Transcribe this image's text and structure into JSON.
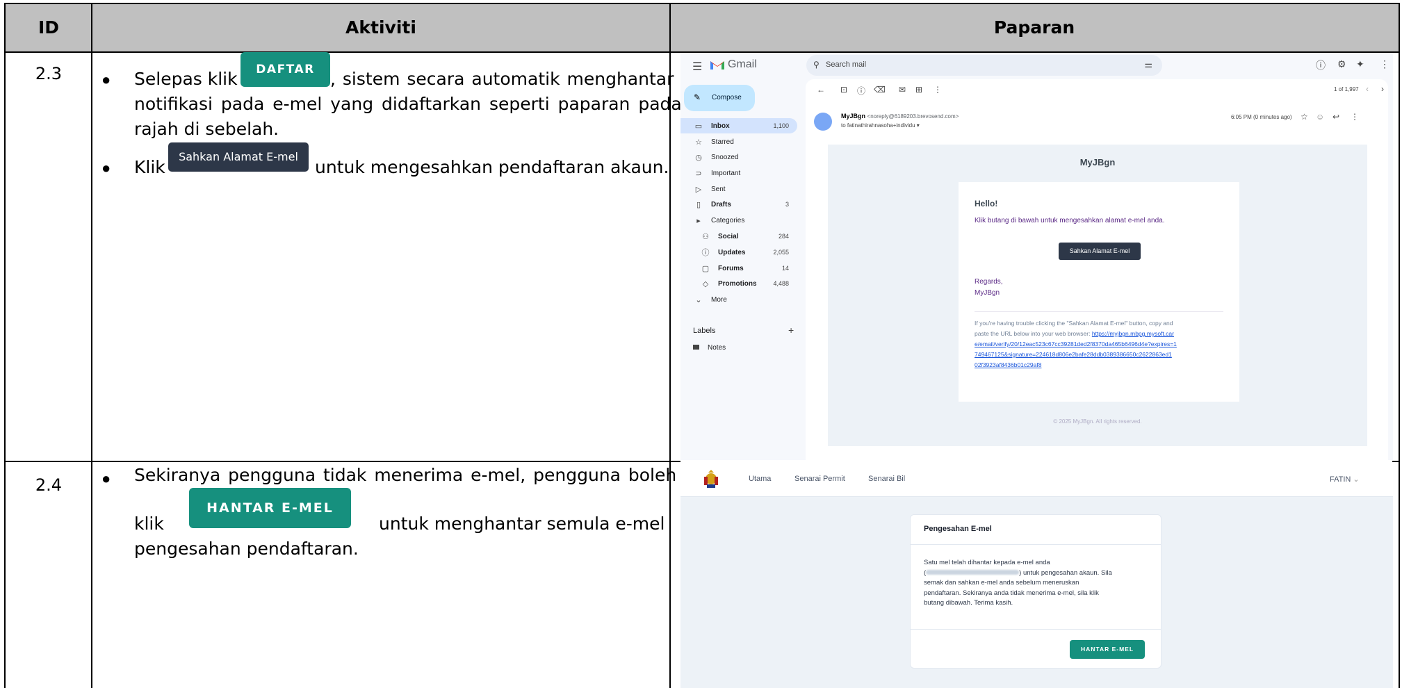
{
  "table": {
    "headers": {
      "id": "ID",
      "activity": "Aktiviti",
      "view": "Paparan"
    },
    "rows": [
      {
        "id": "2.3",
        "bullet1_pre": "Selepas klik",
        "bullet1_btn": "DAFTAR",
        "bullet1_post_line1": ", sistem secara automatik menghantar",
        "bullet1_line2": "notifikasi pada e-mel yang didaftarkan seperti paparan pada",
        "bullet1_line3": "rajah di sebelah.",
        "bullet2_pre": "Klik",
        "bullet2_btn": "Sahkan Alamat E-mel",
        "bullet2_post": "untuk mengesahkan pendaftaran akaun."
      },
      {
        "id": "2.4",
        "bullet1_line1": "Sekiranya pengguna tidak menerima e-mel, pengguna boleh",
        "bullet1_pre2": "klik",
        "bullet1_btn": "HANTAR E-MEL",
        "bullet1_post2": "untuk menghantar semula e-mel",
        "bullet1_line3": "pengesahan pendaftaran."
      }
    ]
  },
  "gmail": {
    "brand": "Gmail",
    "search_placeholder": "Search mail",
    "compose": "Compose",
    "sidebar": [
      {
        "label": "Inbox",
        "count": "1,100",
        "bold": true,
        "icon": "inbox-icon",
        "glyph": "▭"
      },
      {
        "label": "Starred",
        "count": "",
        "bold": false,
        "icon": "star-icon",
        "glyph": "☆"
      },
      {
        "label": "Snoozed",
        "count": "",
        "bold": false,
        "icon": "clock-icon",
        "glyph": "◷"
      },
      {
        "label": "Important",
        "count": "",
        "bold": false,
        "icon": "important-icon",
        "glyph": "⊃"
      },
      {
        "label": "Sent",
        "count": "",
        "bold": false,
        "icon": "send-icon",
        "glyph": "▷"
      },
      {
        "label": "Drafts",
        "count": "3",
        "bold": true,
        "icon": "draft-icon",
        "glyph": "▯"
      },
      {
        "label": "Categories",
        "count": "",
        "bold": false,
        "icon": "label-icon",
        "glyph": "▸"
      },
      {
        "label": "Social",
        "count": "284",
        "bold": true,
        "icon": "people-icon",
        "glyph": "⚇"
      },
      {
        "label": "Updates",
        "count": "2,055",
        "bold": true,
        "icon": "info-icon",
        "glyph": "ⓘ"
      },
      {
        "label": "Forums",
        "count": "14",
        "bold": true,
        "icon": "forum-icon",
        "glyph": "▢"
      },
      {
        "label": "Promotions",
        "count": "4,488",
        "bold": true,
        "icon": "tag-icon",
        "glyph": "◇"
      },
      {
        "label": "More",
        "count": "",
        "bold": false,
        "icon": "chevron-down-icon",
        "glyph": "⌄"
      }
    ],
    "labels_title": "Labels",
    "labels_add": "+",
    "label_notes": "Notes",
    "pagination": "1 of 1,997",
    "sender_name": "MyJBgn",
    "sender_email": "<noreply@6189203.brevosend.com>",
    "to_line": "to fatinathirahnasoha+individu ▾",
    "time": "6:05 PM (0 minutes ago)",
    "email": {
      "brand": "MyJBgn",
      "greeting": "Hello!",
      "intro": "Klik butang di bawah untuk mengesahkan alamat e-mel anda.",
      "button": "Sahkan Alamat E-mel",
      "regards": "Regards,",
      "signature": "MyJBgn",
      "trouble_1": "If you're having trouble clicking the \"Sahkan Alamat E-mel\" button, copy and",
      "trouble_2": "paste the URL below into your web browser:",
      "url_1": "https://myjbgn.mbpg.mysoft.car",
      "url_2": "e/email/verify/20/12eac523c67cc39281ded2f8370da465b6496d4e?expires=1",
      "url_3": "749467125&signature=224618d806e2bafe28ddb0389386650c2622863ed1",
      "url_4": "02f3923af8436b01c29af8",
      "footer": "© 2025 MyJBgn. All rights reserved."
    }
  },
  "portal": {
    "nav": [
      "Utama",
      "Senarai Permit",
      "Senarai Bil"
    ],
    "user": "FATIN",
    "card_title": "Pengesahan E-mel",
    "card_line1": "Satu mel telah dihantar kepada e-mel anda",
    "card_line2_pre": "(",
    "card_line2_post": ") untuk pengesahan akaun. Sila",
    "card_line3": "semak dan sahkan e-mel anda sebelum meneruskan",
    "card_line4": "pendaftaran. Sekiranya anda tidak menerima e-mel, sila klik",
    "card_line5": "butang dibawah. Terima kasih.",
    "button": "HANTAR E-MEL"
  },
  "colors": {
    "teal": "#16907e",
    "dark": "#2d3748",
    "header_bg": "#c0c0c0",
    "link": "#1a56db",
    "purple": "#5b2a86"
  }
}
